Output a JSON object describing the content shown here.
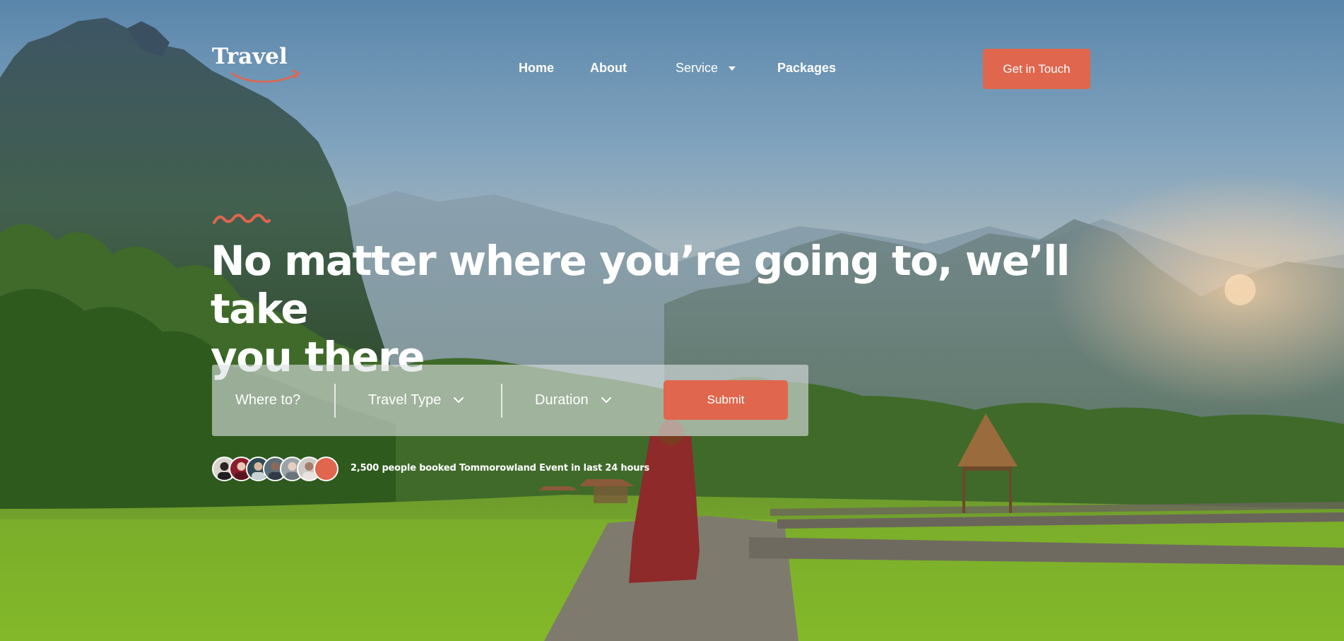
{
  "brand": {
    "logo_text": "Travel",
    "accent": "#e0664e"
  },
  "nav": {
    "items": [
      {
        "label": "Home"
      },
      {
        "label": "About"
      },
      {
        "label": "Service",
        "has_dropdown": true,
        "icon": "caret-down-icon"
      },
      {
        "label": "Packages"
      }
    ],
    "cta_label": "Get in Touch"
  },
  "hero": {
    "decoration_icon": "zigzag-icon",
    "headline_line1": "No matter where you’re going to, we’ll take",
    "headline_line2": "you there"
  },
  "search": {
    "destination_placeholder": "Where to?",
    "travel_type_label": "Travel Type",
    "duration_label": "Duration",
    "dropdown_icon": "chevron-down-icon",
    "submit_label": "Submit"
  },
  "social_proof": {
    "avatar_count": 7,
    "text": "2,500 people booked Tommorowland Event in last 24 hours"
  }
}
